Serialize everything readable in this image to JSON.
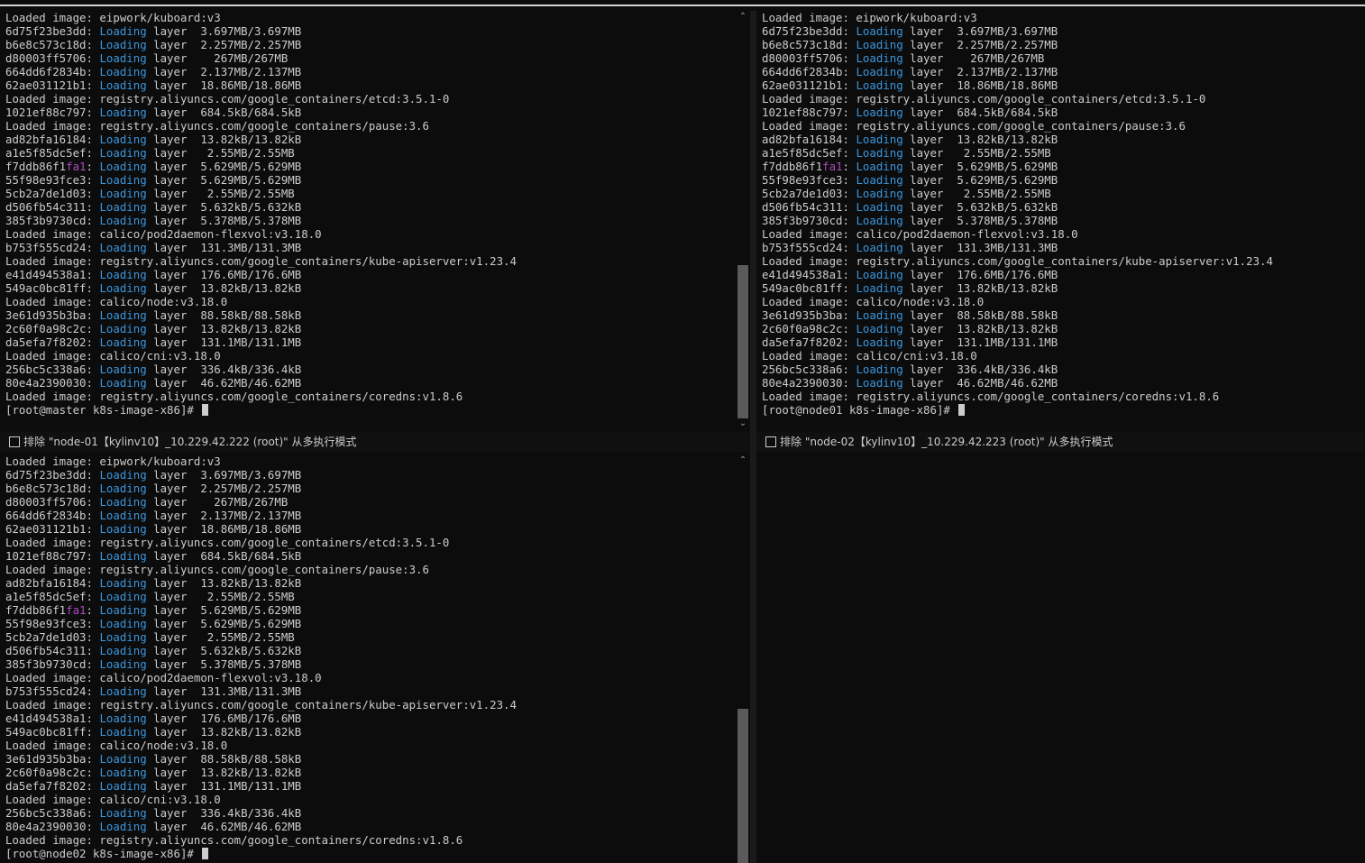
{
  "log_lines": [
    [
      [
        "Loaded image: eipwork/kuboard:v3",
        ""
      ]
    ],
    [
      [
        "6d75f23be3dd: ",
        ""
      ],
      [
        "Loading",
        "kw"
      ],
      [
        " layer  3.697MB/3.697MB",
        ""
      ]
    ],
    [
      [
        "b6e8c573c18d: ",
        ""
      ],
      [
        "Loading",
        "kw"
      ],
      [
        " layer  2.257MB/2.257MB",
        ""
      ]
    ],
    [
      [
        "d80003ff5706: ",
        ""
      ],
      [
        "Loading",
        "kw"
      ],
      [
        " layer    267MB/267MB",
        ""
      ]
    ],
    [
      [
        "664dd6f2834b: ",
        ""
      ],
      [
        "Loading",
        "kw"
      ],
      [
        " layer  2.137MB/2.137MB",
        ""
      ]
    ],
    [
      [
        "62ae031121b1: ",
        ""
      ],
      [
        "Loading",
        "kw"
      ],
      [
        " layer  18.86MB/18.86MB",
        ""
      ]
    ],
    [
      [
        "Loaded image: registry.aliyuncs.com/google_containers/etcd:3.5.1-0",
        ""
      ]
    ],
    [
      [
        "1021ef88c797: ",
        ""
      ],
      [
        "Loading",
        "kw"
      ],
      [
        " layer  684.5kB/684.5kB",
        ""
      ]
    ],
    [
      [
        "Loaded image: registry.aliyuncs.com/google_containers/pause:3.6",
        ""
      ]
    ],
    [
      [
        "ad82bfa16184: ",
        ""
      ],
      [
        "Loading",
        "kw"
      ],
      [
        " layer  13.82kB/13.82kB",
        ""
      ]
    ],
    [
      [
        "a1e5f85dc5ef: ",
        ""
      ],
      [
        "Loading",
        "kw"
      ],
      [
        " layer   2.55MB/2.55MB",
        ""
      ]
    ],
    [
      [
        "f7ddb86f1",
        ""
      ],
      [
        "fa1",
        "mg"
      ],
      [
        ": ",
        ""
      ],
      [
        "Loading",
        "kw"
      ],
      [
        " layer  5.629MB/5.629MB",
        ""
      ]
    ],
    [
      [
        "55f98e93fce3: ",
        ""
      ],
      [
        "Loading",
        "kw"
      ],
      [
        " layer  5.629MB/5.629MB",
        ""
      ]
    ],
    [
      [
        "5cb2a7de1d03: ",
        ""
      ],
      [
        "Loading",
        "kw"
      ],
      [
        " layer   2.55MB/2.55MB",
        ""
      ]
    ],
    [
      [
        "d506fb54c311: ",
        ""
      ],
      [
        "Loading",
        "kw"
      ],
      [
        " layer  5.632kB/5.632kB",
        ""
      ]
    ],
    [
      [
        "385f3b9730cd: ",
        ""
      ],
      [
        "Loading",
        "kw"
      ],
      [
        " layer  5.378MB/5.378MB",
        ""
      ]
    ],
    [
      [
        "Loaded image: calico/pod2daemon-flexvol:v3.18.0",
        ""
      ]
    ],
    [
      [
        "b753f555cd24: ",
        ""
      ],
      [
        "Loading",
        "kw"
      ],
      [
        " layer  131.3MB/131.3MB",
        ""
      ]
    ],
    [
      [
        "Loaded image: registry.aliyuncs.com/google_containers/kube-apiserver:v1.23.4",
        ""
      ]
    ],
    [
      [
        "e41d494538a1: ",
        ""
      ],
      [
        "Loading",
        "kw"
      ],
      [
        " layer  176.6MB/176.6MB",
        ""
      ]
    ],
    [
      [
        "549ac0bc81ff: ",
        ""
      ],
      [
        "Loading",
        "kw"
      ],
      [
        " layer  13.82kB/13.82kB",
        ""
      ]
    ],
    [
      [
        "Loaded image: calico/node:v3.18.0",
        ""
      ]
    ],
    [
      [
        "3e61d935b3ba: ",
        ""
      ],
      [
        "Loading",
        "kw"
      ],
      [
        " layer  88.58kB/88.58kB",
        ""
      ]
    ],
    [
      [
        "2c60f0a98c2c: ",
        ""
      ],
      [
        "Loading",
        "kw"
      ],
      [
        " layer  13.82kB/13.82kB",
        ""
      ]
    ],
    [
      [
        "da5efa7f8202: ",
        ""
      ],
      [
        "Loading",
        "kw"
      ],
      [
        " layer  131.1MB/131.1MB",
        ""
      ]
    ],
    [
      [
        "Loaded image: calico/cni:v3.18.0",
        ""
      ]
    ],
    [
      [
        "256bc5c338a6: ",
        ""
      ],
      [
        "Loading",
        "kw"
      ],
      [
        " layer  336.4kB/336.4kB",
        ""
      ]
    ],
    [
      [
        "80e4a2390030: ",
        ""
      ],
      [
        "Loading",
        "kw"
      ],
      [
        " layer  46.62MB/46.62MB",
        ""
      ]
    ],
    [
      [
        "Loaded image: registry.aliyuncs.com/google_containers/coredns:v1.8.6",
        ""
      ]
    ]
  ],
  "panes": {
    "master": {
      "prompt": "[root@master k8s-image-x86]# "
    },
    "node01": {
      "prompt": "[root@node01 k8s-image-x86]# "
    },
    "node02": {
      "prompt": "[root@node02 k8s-image-x86]# "
    }
  },
  "exclude_bars": {
    "node01": "排除 \"node-01【kylinv10】_10.229.42.222 (root)\" 从多执行模式",
    "node02": "排除 \"node-02【kylinv10】_10.229.42.223 (root)\" 从多执行模式"
  },
  "scroll": {
    "up_icon": "scroll-up-arrow",
    "down_icon": "scroll-down-arrow"
  },
  "colors": {
    "background": "#0c0c0c",
    "text": "#cccccc",
    "loading": "#3a96dd",
    "highlight": "#b148c6"
  }
}
